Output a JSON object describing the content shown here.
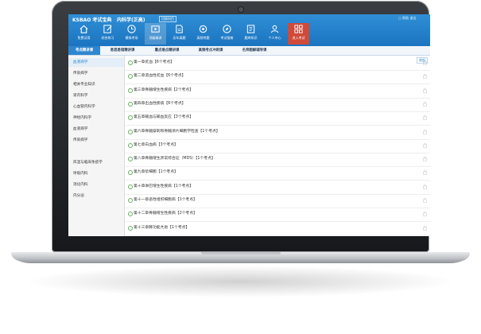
{
  "header": {
    "logo": "KSBAO 考试宝典",
    "course": "内科学(正高)",
    "switch_label": "切换科目",
    "top_link": "□ 帮助 退出",
    "nav": [
      {
        "label": "免费试用",
        "icon": "home-icon"
      },
      {
        "label": "综合练习",
        "icon": "edit-icon"
      },
      {
        "label": "模拟考场",
        "icon": "clock-icon"
      },
      {
        "label": "顶级精讲",
        "icon": "video-icon"
      },
      {
        "label": "历年真题",
        "icon": "document-icon"
      },
      {
        "label": "高频考题",
        "icon": "settings-icon"
      },
      {
        "label": "考试指南",
        "icon": "compass-icon"
      },
      {
        "label": "题库知识",
        "icon": "book-icon"
      },
      {
        "label": "个人中心",
        "icon": "user-icon"
      },
      {
        "label": "进入考试",
        "icon": "grid-icon"
      }
    ]
  },
  "tabs": [
    "考点精讲课",
    "易混易错精讲课",
    "重点难点精讲课",
    "高频考点冲刺课",
    "名师图解辅导课"
  ],
  "sidebar": {
    "items": [
      "血液病学",
      "传染病学",
      "相关专业知识",
      "肾内科学",
      "心血管内科学",
      "神经内科学",
      "血液病学",
      "传染病学",
      "风湿与临床免疫学",
      "呼吸内科",
      "消化内科",
      "内分泌"
    ]
  },
  "main": {
    "collapse_label": "收起",
    "rows": [
      "第一章贫血【6个考点】",
      "第二章溶血性贫血【6个考点】",
      "第三章骨髓增生性疾病【2个考点】",
      "第四章出血性疾病【8个考点】",
      "第五章输血与输血反应【3个考点】",
      "第六章骨髓穿刺和骨髓涂片细胞学检查【1个考点】",
      "第七章白血病【3个考点】",
      "第八章骨髓增生异常综合征（MDS）【1个考点】",
      "第九章浆细胞【1个考点】",
      "第十章淋巴增生性疾病【1个考点】",
      "第十一章恶性组织细胞病【1个考点】",
      "第十二章骨髓增生性疾病【2个考点】",
      "第十三章脾功能亢进【1个考点】"
    ]
  },
  "colors": {
    "header": "#1b74c0",
    "accent": "#2f86cf",
    "exam": "#cf4a3a",
    "bullet": "#5fb35a"
  }
}
